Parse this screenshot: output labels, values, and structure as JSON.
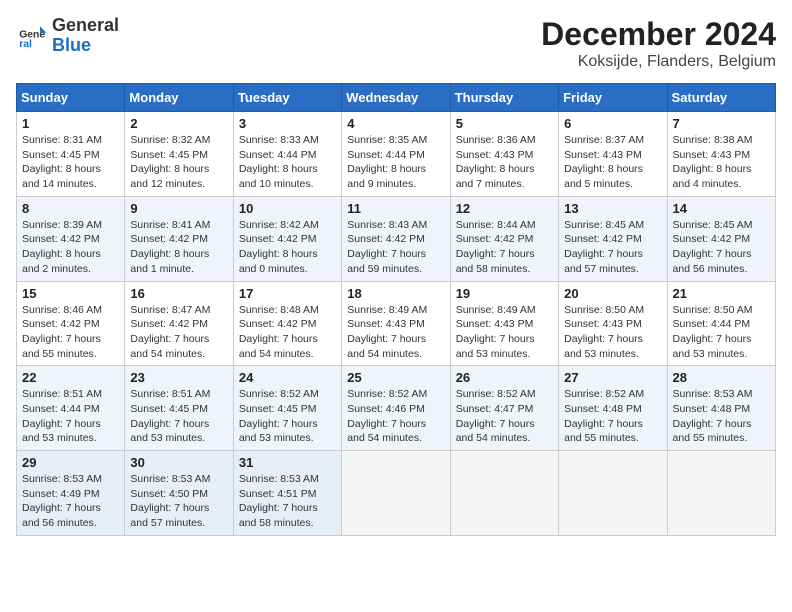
{
  "header": {
    "logo": {
      "line1": "General",
      "line2": "Blue"
    },
    "title": "December 2024",
    "subtitle": "Koksijde, Flanders, Belgium"
  },
  "weekdays": [
    "Sunday",
    "Monday",
    "Tuesday",
    "Wednesday",
    "Thursday",
    "Friday",
    "Saturday"
  ],
  "weeks": [
    [
      {
        "day": "1",
        "sunrise": "Sunrise: 8:31 AM",
        "sunset": "Sunset: 4:45 PM",
        "daylight": "Daylight: 8 hours and 14 minutes."
      },
      {
        "day": "2",
        "sunrise": "Sunrise: 8:32 AM",
        "sunset": "Sunset: 4:45 PM",
        "daylight": "Daylight: 8 hours and 12 minutes."
      },
      {
        "day": "3",
        "sunrise": "Sunrise: 8:33 AM",
        "sunset": "Sunset: 4:44 PM",
        "daylight": "Daylight: 8 hours and 10 minutes."
      },
      {
        "day": "4",
        "sunrise": "Sunrise: 8:35 AM",
        "sunset": "Sunset: 4:44 PM",
        "daylight": "Daylight: 8 hours and 9 minutes."
      },
      {
        "day": "5",
        "sunrise": "Sunrise: 8:36 AM",
        "sunset": "Sunset: 4:43 PM",
        "daylight": "Daylight: 8 hours and 7 minutes."
      },
      {
        "day": "6",
        "sunrise": "Sunrise: 8:37 AM",
        "sunset": "Sunset: 4:43 PM",
        "daylight": "Daylight: 8 hours and 5 minutes."
      },
      {
        "day": "7",
        "sunrise": "Sunrise: 8:38 AM",
        "sunset": "Sunset: 4:43 PM",
        "daylight": "Daylight: 8 hours and 4 minutes."
      }
    ],
    [
      {
        "day": "8",
        "sunrise": "Sunrise: 8:39 AM",
        "sunset": "Sunset: 4:42 PM",
        "daylight": "Daylight: 8 hours and 2 minutes."
      },
      {
        "day": "9",
        "sunrise": "Sunrise: 8:41 AM",
        "sunset": "Sunset: 4:42 PM",
        "daylight": "Daylight: 8 hours and 1 minute."
      },
      {
        "day": "10",
        "sunrise": "Sunrise: 8:42 AM",
        "sunset": "Sunset: 4:42 PM",
        "daylight": "Daylight: 8 hours and 0 minutes."
      },
      {
        "day": "11",
        "sunrise": "Sunrise: 8:43 AM",
        "sunset": "Sunset: 4:42 PM",
        "daylight": "Daylight: 7 hours and 59 minutes."
      },
      {
        "day": "12",
        "sunrise": "Sunrise: 8:44 AM",
        "sunset": "Sunset: 4:42 PM",
        "daylight": "Daylight: 7 hours and 58 minutes."
      },
      {
        "day": "13",
        "sunrise": "Sunrise: 8:45 AM",
        "sunset": "Sunset: 4:42 PM",
        "daylight": "Daylight: 7 hours and 57 minutes."
      },
      {
        "day": "14",
        "sunrise": "Sunrise: 8:45 AM",
        "sunset": "Sunset: 4:42 PM",
        "daylight": "Daylight: 7 hours and 56 minutes."
      }
    ],
    [
      {
        "day": "15",
        "sunrise": "Sunrise: 8:46 AM",
        "sunset": "Sunset: 4:42 PM",
        "daylight": "Daylight: 7 hours and 55 minutes."
      },
      {
        "day": "16",
        "sunrise": "Sunrise: 8:47 AM",
        "sunset": "Sunset: 4:42 PM",
        "daylight": "Daylight: 7 hours and 54 minutes."
      },
      {
        "day": "17",
        "sunrise": "Sunrise: 8:48 AM",
        "sunset": "Sunset: 4:42 PM",
        "daylight": "Daylight: 7 hours and 54 minutes."
      },
      {
        "day": "18",
        "sunrise": "Sunrise: 8:49 AM",
        "sunset": "Sunset: 4:43 PM",
        "daylight": "Daylight: 7 hours and 54 minutes."
      },
      {
        "day": "19",
        "sunrise": "Sunrise: 8:49 AM",
        "sunset": "Sunset: 4:43 PM",
        "daylight": "Daylight: 7 hours and 53 minutes."
      },
      {
        "day": "20",
        "sunrise": "Sunrise: 8:50 AM",
        "sunset": "Sunset: 4:43 PM",
        "daylight": "Daylight: 7 hours and 53 minutes."
      },
      {
        "day": "21",
        "sunrise": "Sunrise: 8:50 AM",
        "sunset": "Sunset: 4:44 PM",
        "daylight": "Daylight: 7 hours and 53 minutes."
      }
    ],
    [
      {
        "day": "22",
        "sunrise": "Sunrise: 8:51 AM",
        "sunset": "Sunset: 4:44 PM",
        "daylight": "Daylight: 7 hours and 53 minutes."
      },
      {
        "day": "23",
        "sunrise": "Sunrise: 8:51 AM",
        "sunset": "Sunset: 4:45 PM",
        "daylight": "Daylight: 7 hours and 53 minutes."
      },
      {
        "day": "24",
        "sunrise": "Sunrise: 8:52 AM",
        "sunset": "Sunset: 4:45 PM",
        "daylight": "Daylight: 7 hours and 53 minutes."
      },
      {
        "day": "25",
        "sunrise": "Sunrise: 8:52 AM",
        "sunset": "Sunset: 4:46 PM",
        "daylight": "Daylight: 7 hours and 54 minutes."
      },
      {
        "day": "26",
        "sunrise": "Sunrise: 8:52 AM",
        "sunset": "Sunset: 4:47 PM",
        "daylight": "Daylight: 7 hours and 54 minutes."
      },
      {
        "day": "27",
        "sunrise": "Sunrise: 8:52 AM",
        "sunset": "Sunset: 4:48 PM",
        "daylight": "Daylight: 7 hours and 55 minutes."
      },
      {
        "day": "28",
        "sunrise": "Sunrise: 8:53 AM",
        "sunset": "Sunset: 4:48 PM",
        "daylight": "Daylight: 7 hours and 55 minutes."
      }
    ],
    [
      {
        "day": "29",
        "sunrise": "Sunrise: 8:53 AM",
        "sunset": "Sunset: 4:49 PM",
        "daylight": "Daylight: 7 hours and 56 minutes."
      },
      {
        "day": "30",
        "sunrise": "Sunrise: 8:53 AM",
        "sunset": "Sunset: 4:50 PM",
        "daylight": "Daylight: 7 hours and 57 minutes."
      },
      {
        "day": "31",
        "sunrise": "Sunrise: 8:53 AM",
        "sunset": "Sunset: 4:51 PM",
        "daylight": "Daylight: 7 hours and 58 minutes."
      },
      null,
      null,
      null,
      null
    ]
  ]
}
